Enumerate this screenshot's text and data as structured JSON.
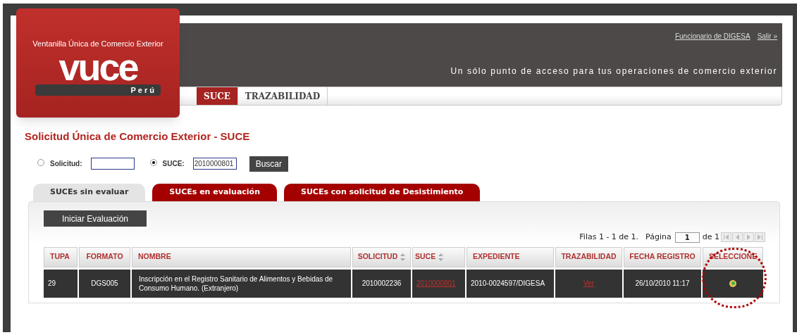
{
  "logo": {
    "tagline": "Ventanilla Única de Comercio Exterior",
    "wordmark": "vuce",
    "country": "Perú"
  },
  "header": {
    "links": [
      "Funcionario de DIGESA",
      "Salir »"
    ],
    "slogan": "Un sólo punto de acceso para tus operaciones de comercio exterior"
  },
  "nav": [
    {
      "label": "SUCE",
      "selected": true
    },
    {
      "label": "TRAZABILIDAD",
      "selected": false
    }
  ],
  "title": "Solicitud Única de Comercio Exterior - SUCE",
  "search": {
    "options": [
      {
        "label": "Solicitud:",
        "selected": false
      },
      {
        "label": "SUCE:",
        "selected": true,
        "value": "2010000801"
      }
    ],
    "button": "Buscar"
  },
  "tabs": [
    {
      "label": "SUCEs sin evaluar",
      "selected": true
    },
    {
      "label": "SUCEs en evaluación",
      "selected": false
    },
    {
      "label": "SUCEs con solicitud de Desistimiento",
      "selected": false
    }
  ],
  "action_button": "Iniciar Evaluación",
  "pager": {
    "rows": "Filas 1 - 1 de 1.",
    "page_label": "Página",
    "page": "1",
    "of": "de 1"
  },
  "table": {
    "columns": [
      {
        "label": "TUPA",
        "sortable": false
      },
      {
        "label": "FORMATO",
        "sortable": false
      },
      {
        "label": "NOMBRE",
        "sortable": false
      },
      {
        "label": "SOLICITUD",
        "sortable": true
      },
      {
        "label": "SUCE",
        "sortable": true
      },
      {
        "label": "EXPEDIENTE",
        "sortable": false
      },
      {
        "label": "TRAZABILIDAD",
        "sortable": false
      },
      {
        "label": "FECHA REGISTRO",
        "sortable": false
      },
      {
        "label": "SELECCIONE",
        "sortable": false
      }
    ],
    "rows": [
      {
        "tupa": "29",
        "formato": "DGS005",
        "nombre": "Inscripción en el Registro Sanitario de Alimentos y Bebidas de Consumo Humano. (Extranjero)",
        "solicitud": "2010002236",
        "suce": "2010000801",
        "expediente": "2010-0024597/DIGESA",
        "trazabilidad": "Ver",
        "fecha": "26/10/2010 11:17",
        "selected": true
      }
    ]
  }
}
